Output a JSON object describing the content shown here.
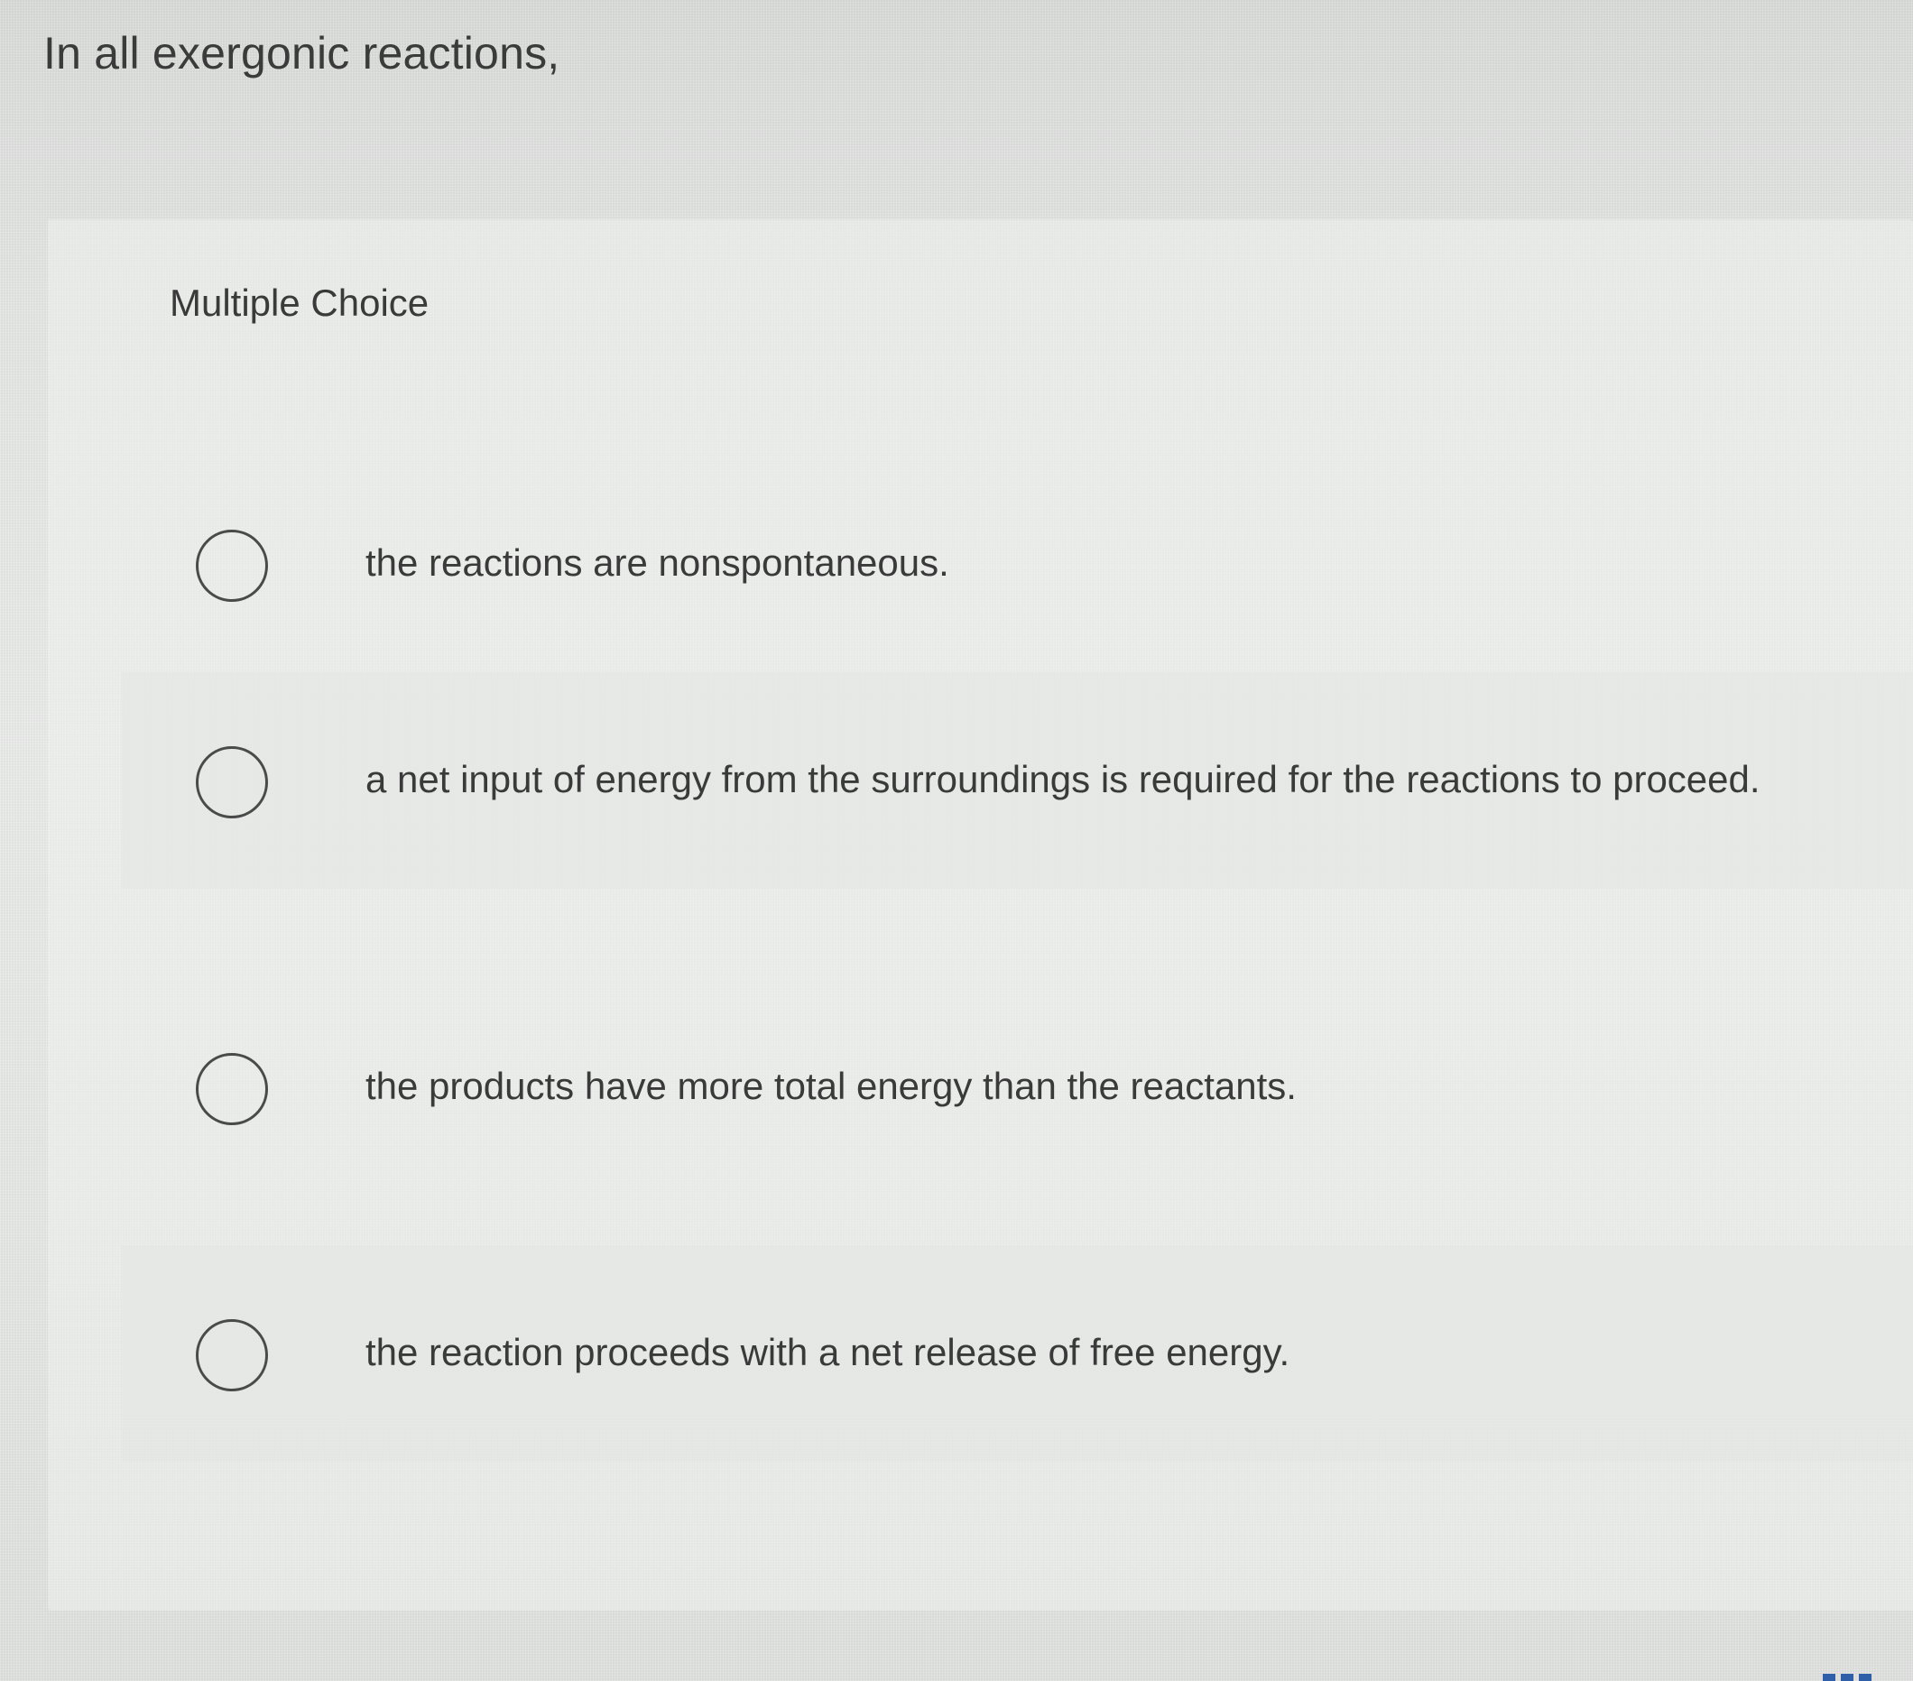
{
  "question": {
    "prompt": "In all exergonic reactions,",
    "type_label": "Multiple Choice"
  },
  "choices": [
    {
      "text": "the reactions are nonspontaneous.",
      "icon": "radio-unselected-icon",
      "selected": false
    },
    {
      "text": "a net input of energy from the surroundings is required for the reactions to proceed.",
      "icon": "radio-unselected-icon",
      "selected": false
    },
    {
      "text": "the products have more total energy than the reactants.",
      "icon": "radio-unselected-icon",
      "selected": false
    },
    {
      "text": "the reaction proceeds with a net release of free energy.",
      "icon": "radio-unselected-icon",
      "selected": false
    }
  ],
  "colors": {
    "background": "#e6e8e6",
    "text": "#3a3a3a",
    "radio_border": "#4a4a4a",
    "corner_accent": "#2f5fa8"
  }
}
